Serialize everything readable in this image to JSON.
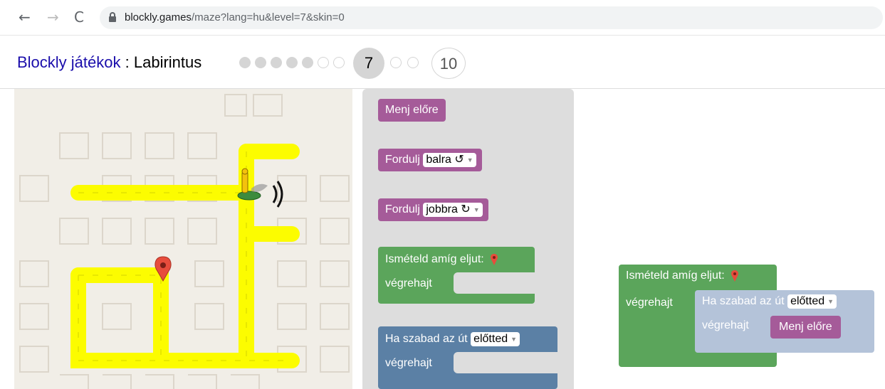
{
  "browser": {
    "back_icon": "arrow-left-icon",
    "forward_icon": "arrow-right-icon",
    "reload_icon": "reload-icon",
    "lock_icon": "lock-icon",
    "url_domain": "blockly.games",
    "url_path": "/maze?lang=hu&level=7&skin=0"
  },
  "header": {
    "app_link": "Blockly játékok",
    "separator": " : ",
    "game_title": "Labirintus",
    "completed_levels": 4,
    "current_level": "7",
    "last_level": "10"
  },
  "toolbox": {
    "move_forward": "Menj előre",
    "turn_label": "Fordulj",
    "turn_left_value": "balra ↺",
    "turn_right_value": "jobbra ↻",
    "repeat_label": "Ismételd amíg eljut:",
    "do_label": "végrehajt",
    "if_label": "Ha szabad az út",
    "if_dir_value": "előtted",
    "if_do_label": "végrehajt"
  },
  "workspace": {
    "repeat_label": "Ismételd amíg eljut:",
    "do_label": "végrehajt",
    "if_label": "Ha szabad az út",
    "if_dir_value": "előtted",
    "if_do_label": "végrehajt",
    "move_forward": "Menj előre"
  },
  "colors": {
    "move_block": "#a55b99",
    "loop_block": "#5ba55b",
    "if_block": "#5b80a5",
    "path": "#fcfc00",
    "maze_bg": "#f1eee7",
    "marker": "#e74c3c"
  },
  "icons": {
    "marker": "map-marker-icon",
    "pegman": "pegman-icon",
    "goal": "goal-marker-icon"
  }
}
